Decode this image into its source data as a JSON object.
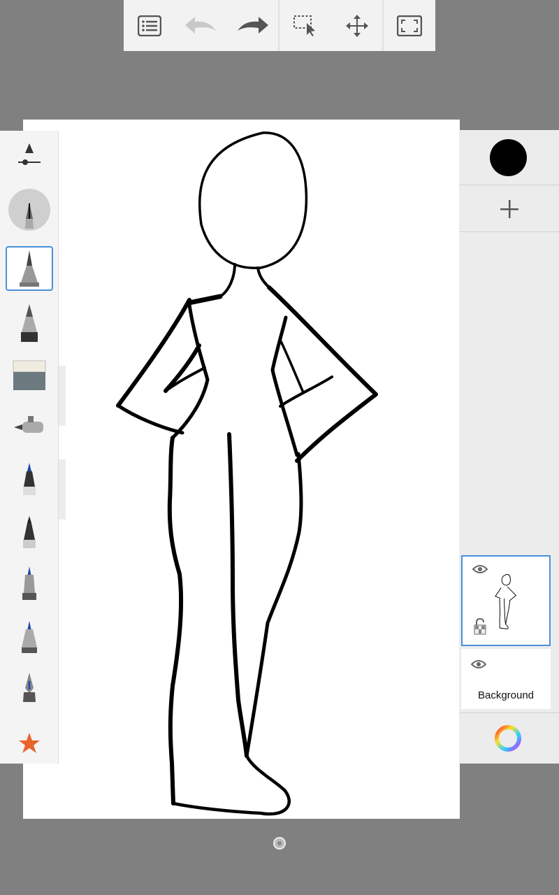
{
  "toolbar": {
    "icons": [
      "list-icon",
      "undo-icon",
      "redo-icon",
      "selection-icon",
      "move-icon",
      "fullscreen-icon"
    ]
  },
  "left_toolbar": {
    "tools": [
      "brush-settings",
      "pencil-active",
      "pencil",
      "marker",
      "eraser",
      "airbrush",
      "ballpoint-pen",
      "fine-pen",
      "ink-pen",
      "chisel-pen",
      "fountain-pen",
      "favorites-star"
    ],
    "selected": "pencil"
  },
  "right_panel": {
    "current_color": "#000000",
    "layers": [
      {
        "name": "",
        "selected": true,
        "visible": true
      },
      {
        "name": "Background",
        "selected": false,
        "visible": true
      }
    ]
  },
  "colors": {
    "accent": "#4a90d9",
    "backdrop": "#808080",
    "favorite_star": "#e8642a"
  }
}
